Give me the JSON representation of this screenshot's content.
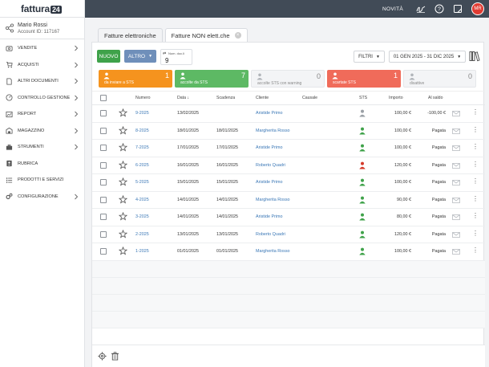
{
  "app": {
    "logo_text": "fattura",
    "logo_badge": "24",
    "news_label": "NOVITÀ",
    "avatar_initials": "MR"
  },
  "account": {
    "name": "Mario Rossi",
    "account_id": "Account ID: 117167"
  },
  "sidebar": {
    "items": [
      {
        "label": "VENDITE",
        "icon": "sales-icon",
        "has_chevron": true
      },
      {
        "label": "ACQUISTI",
        "icon": "cart-icon",
        "has_chevron": true
      },
      {
        "label": "ALTRI DOCUMENTI",
        "icon": "document-icon",
        "has_chevron": true
      },
      {
        "label": "CONTROLLO GESTIONE",
        "icon": "dashboard-icon",
        "has_chevron": true
      },
      {
        "label": "REPORT",
        "icon": "chart-icon",
        "has_chevron": true
      },
      {
        "label": "MAGAZZINO",
        "icon": "warehouse-icon",
        "has_chevron": true
      },
      {
        "label": "STRUMENTI",
        "icon": "briefcase-icon",
        "has_chevron": true
      },
      {
        "label": "RUBRICA",
        "icon": "contacts-icon",
        "has_chevron": false
      },
      {
        "label": "PRODOTTI E SERVIZI",
        "icon": "list-icon",
        "has_chevron": false
      },
      {
        "label": "CONFIGURAZIONE",
        "icon": "gears-icon",
        "has_chevron": true
      }
    ]
  },
  "tabs": [
    {
      "label": "Fatture elettroniche",
      "active": false
    },
    {
      "label": "Fatture NON elett.che",
      "active": true
    }
  ],
  "toolbar": {
    "new_label": "NUOVO",
    "more_label": "ALTRO",
    "num_docs_label": "Num. doc.li",
    "num_docs_value": "9",
    "filters_label": "FILTRI",
    "date_range_label": "01 GEN 2025 - 31 DIC 2025"
  },
  "status_cards": [
    {
      "label": "da inviare a STS",
      "count": "1",
      "color": "#f5931e"
    },
    {
      "label": "accolte da STS",
      "count": "7",
      "color": "#5db964"
    },
    {
      "label": "accolte STS con warning",
      "count": "0",
      "color": "#f3f4f6"
    },
    {
      "label": "scartate STS",
      "count": "1",
      "color": "#f06b5a"
    },
    {
      "label": "disattive",
      "count": "0",
      "color": "#f3f4f6"
    }
  ],
  "table": {
    "headers": {
      "numero": "Numero",
      "data": "Data ↓",
      "scadenza": "Scadenza",
      "cliente": "Cliente",
      "causale": "Causale",
      "sts": "STS",
      "importo": "Importo",
      "al_saldo": "Al saldo"
    },
    "rows": [
      {
        "numero": "9-2025",
        "data": "13/02/2025",
        "scadenza": "",
        "cliente": "Aristide Primo",
        "sts": "gray",
        "importo": "100,00 €",
        "saldo": "-100,00 €",
        "saldo_type": "neg"
      },
      {
        "numero": "8-2025",
        "data": "18/01/2025",
        "scadenza": "18/01/2025",
        "cliente": "Margherita Rosso",
        "sts": "green",
        "importo": "100,00 €",
        "saldo": "Pagata",
        "saldo_type": "paid"
      },
      {
        "numero": "7-2025",
        "data": "17/01/2025",
        "scadenza": "17/01/2025",
        "cliente": "Aristide Primo",
        "sts": "green",
        "importo": "100,00 €",
        "saldo": "Pagata",
        "saldo_type": "paid"
      },
      {
        "numero": "6-2025",
        "data": "16/01/2025",
        "scadenza": "16/01/2025",
        "cliente": "Roberto Quadri",
        "sts": "red",
        "importo": "120,00 €",
        "saldo": "Pagata",
        "saldo_type": "paid"
      },
      {
        "numero": "5-2025",
        "data": "15/01/2025",
        "scadenza": "15/01/2025",
        "cliente": "Aristide Primo",
        "sts": "green",
        "importo": "100,00 €",
        "saldo": "Pagata",
        "saldo_type": "paid"
      },
      {
        "numero": "4-2025",
        "data": "14/01/2025",
        "scadenza": "14/01/2025",
        "cliente": "Margherita Rosso",
        "sts": "green",
        "importo": "90,00 €",
        "saldo": "Pagata",
        "saldo_type": "paid"
      },
      {
        "numero": "3-2025",
        "data": "14/01/2025",
        "scadenza": "14/01/2025",
        "cliente": "Aristide Primo",
        "sts": "green",
        "importo": "80,00 €",
        "saldo": "Pagata",
        "saldo_type": "paid"
      },
      {
        "numero": "2-2025",
        "data": "13/01/2025",
        "scadenza": "13/01/2025",
        "cliente": "Roberto Quadri",
        "sts": "green",
        "importo": "120,00 €",
        "saldo": "Pagata",
        "saldo_type": "paid"
      },
      {
        "numero": "1-2025",
        "data": "01/01/2025",
        "scadenza": "01/01/2025",
        "cliente": "Margherita Rosso",
        "sts": "green",
        "importo": "100,00 €",
        "saldo": "Pagata",
        "saldo_type": "paid"
      }
    ],
    "sts_colors": {
      "gray": "#9aa0a6",
      "green": "#3fa24a",
      "red": "#d53a2a"
    }
  },
  "footer": {
    "icons": [
      "settings-icon",
      "trash-icon"
    ]
  }
}
